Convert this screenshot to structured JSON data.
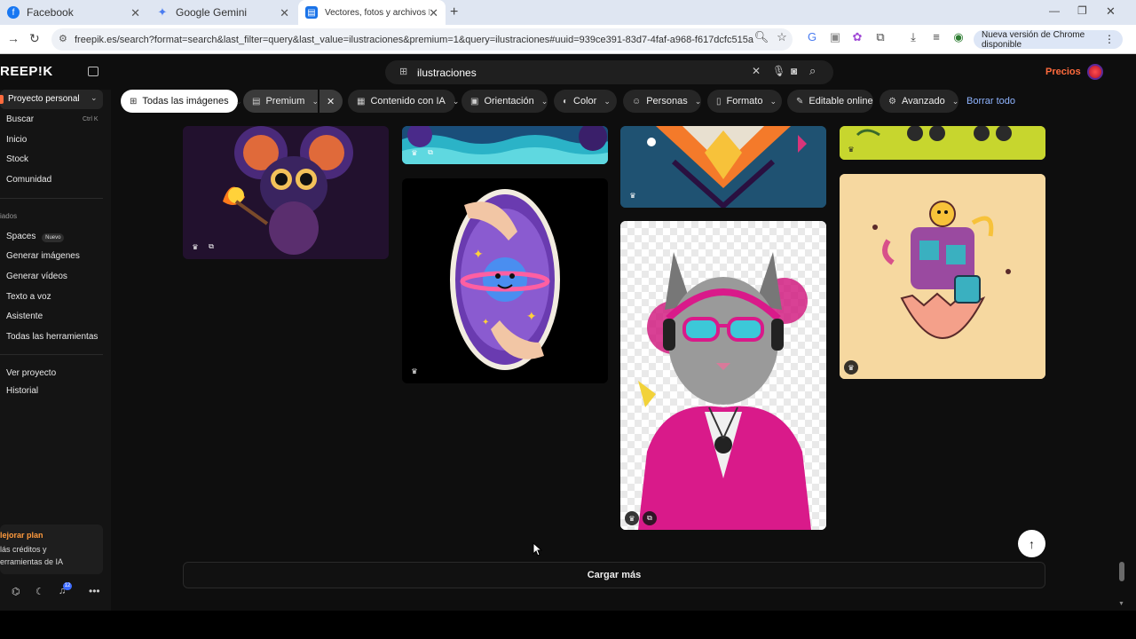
{
  "browser": {
    "tabs": [
      {
        "title": "Facebook",
        "icon": "facebook-icon"
      },
      {
        "title": "Google Gemini",
        "icon": "gemini-icon"
      },
      {
        "title": "Vectores, fotos y archivos PSD",
        "icon": "freepik-icon"
      }
    ],
    "url": "freepik.es/search?format=search&last_filter=query&last_value=ilustraciones&premium=1&query=ilustraciones#uuid=939ce391-83d7-4faf-a968-f617dcfc515a",
    "update_label": "Nueva versión de Chrome disponible"
  },
  "app": {
    "logo": "REEP!K",
    "search_value": "ilustraciones",
    "pricing_label": "Precios"
  },
  "filters": [
    {
      "label": "Todas las imágenes",
      "icon": "grid-icon"
    },
    {
      "label": "Premium",
      "icon": "premium-icon"
    },
    {
      "label": "Contenido con IA",
      "icon": "ai-icon"
    },
    {
      "label": "Orientación",
      "icon": "orientation-icon"
    },
    {
      "label": "Color",
      "icon": "color-icon"
    },
    {
      "label": "Personas",
      "icon": "people-icon"
    },
    {
      "label": "Formato",
      "icon": "file-icon"
    },
    {
      "label": "Editable online",
      "icon": "pen-icon"
    },
    {
      "label": "Avanzado",
      "icon": "settings-icon"
    }
  ],
  "clear_all_label": "Borrar todo",
  "sidebar": {
    "project": "Proyecto personal",
    "items": [
      {
        "label": "Buscar",
        "shortcut": "Ctrl K"
      },
      {
        "label": "Inicio"
      },
      {
        "label": "Stock"
      },
      {
        "label": "Comunidad"
      }
    ],
    "section_label": "iados",
    "tools": [
      {
        "label": "Spaces",
        "badge": "Nuevo"
      },
      {
        "label": "Generar imágenes"
      },
      {
        "label": "Generar vídeos"
      },
      {
        "label": "Texto a voz"
      },
      {
        "label": "Asistente"
      },
      {
        "label": "Todas las herramientas"
      }
    ],
    "project_links": [
      {
        "label": "Ver proyecto"
      },
      {
        "label": "Historial"
      }
    ],
    "upgrade": {
      "title": "lejorar plan",
      "line1": "lás créditos y",
      "line2": "erramientas de IA"
    },
    "notification_count": "12"
  },
  "load_more_label": "Cargar más",
  "colors": {
    "background": "#0e0e0e",
    "accent": "#ff6b3d",
    "link": "#8fb4ff"
  }
}
